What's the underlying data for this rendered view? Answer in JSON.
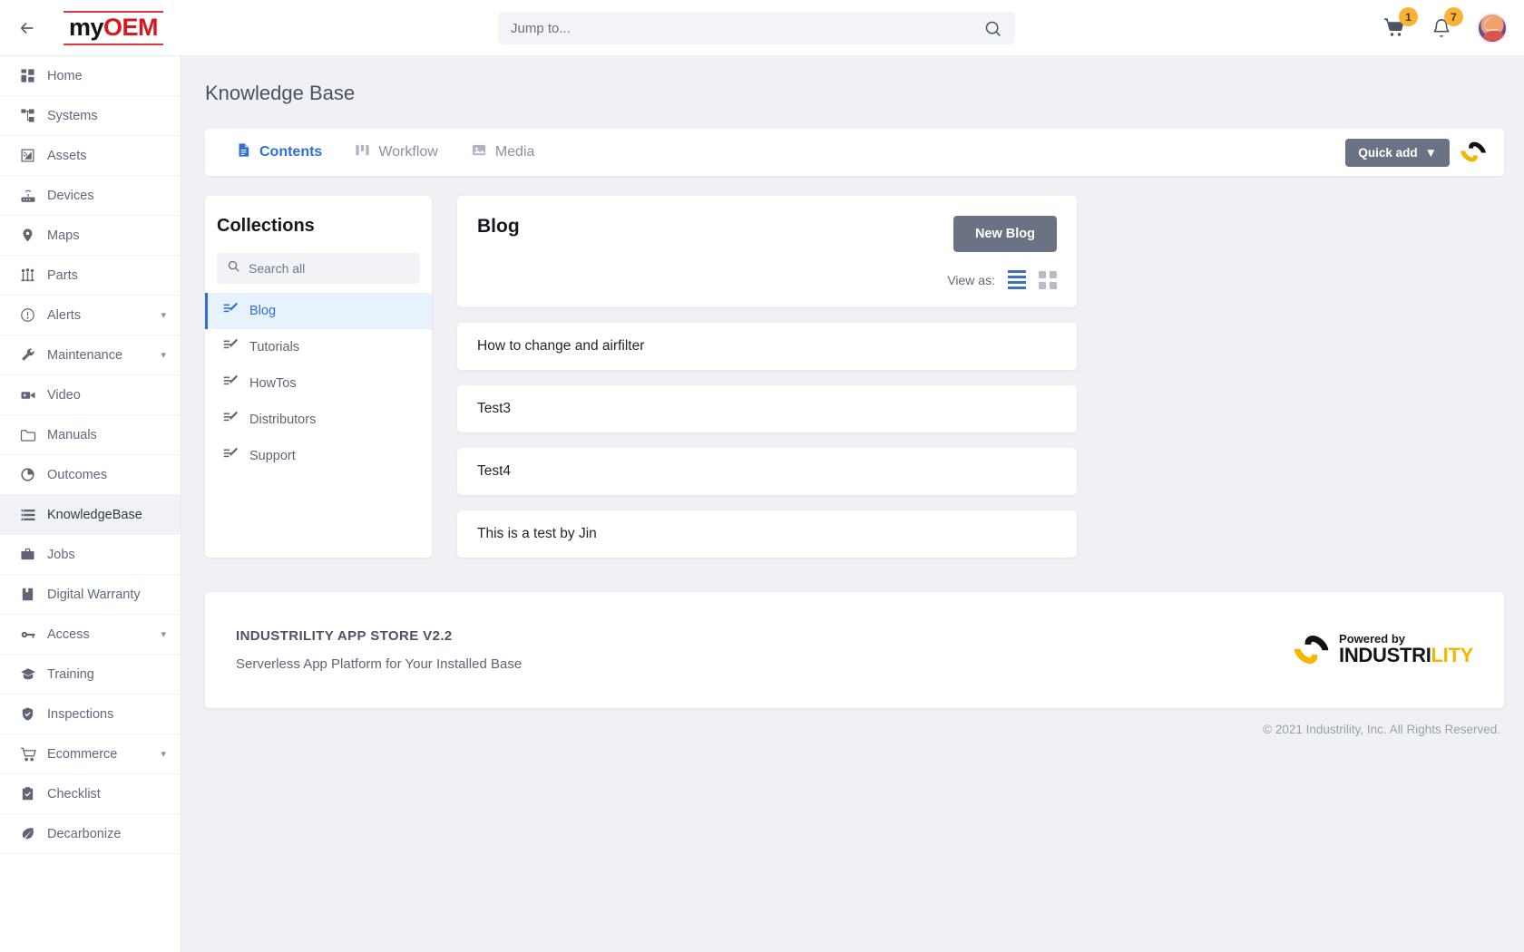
{
  "topbar": {
    "back_icon": "arrow-left-icon",
    "logo": {
      "part1": "my",
      "part2": "OEM"
    },
    "search": {
      "placeholder": "Jump to...",
      "value": "",
      "icon": "search-icon"
    },
    "cart": {
      "icon": "cart-icon",
      "badge": "1"
    },
    "notifications": {
      "icon": "bell-icon",
      "badge": "7"
    },
    "avatar": {
      "icon": "user-avatar"
    }
  },
  "sidebar": {
    "items": [
      {
        "label": "Home",
        "icon": "dashboard-icon",
        "active": false,
        "chevron": false
      },
      {
        "label": "Systems",
        "icon": "sitemap-icon",
        "active": false,
        "chevron": false
      },
      {
        "label": "Assets",
        "icon": "asset-cast-icon",
        "active": false,
        "chevron": false
      },
      {
        "label": "Devices",
        "icon": "router-icon",
        "active": false,
        "chevron": false
      },
      {
        "label": "Maps",
        "icon": "map-pin-icon",
        "active": false,
        "chevron": false
      },
      {
        "label": "Parts",
        "icon": "parts-icon",
        "active": false,
        "chevron": false
      },
      {
        "label": "Alerts",
        "icon": "alert-circle-icon",
        "active": false,
        "chevron": true
      },
      {
        "label": "Maintenance",
        "icon": "wrench-icon",
        "active": false,
        "chevron": true
      },
      {
        "label": "Video",
        "icon": "video-camera-icon",
        "active": false,
        "chevron": false
      },
      {
        "label": "Manuals",
        "icon": "folder-icon",
        "active": false,
        "chevron": false
      },
      {
        "label": "Outcomes",
        "icon": "pie-chart-icon",
        "active": false,
        "chevron": false
      },
      {
        "label": "KnowledgeBase",
        "icon": "list-icon",
        "active": true,
        "chevron": false
      },
      {
        "label": "Jobs",
        "icon": "briefcase-icon",
        "active": false,
        "chevron": false
      },
      {
        "label": "Digital Warranty",
        "icon": "book-icon",
        "active": false,
        "chevron": false
      },
      {
        "label": "Access",
        "icon": "key-icon",
        "active": false,
        "chevron": true
      },
      {
        "label": "Training",
        "icon": "graduation-cap-icon",
        "active": false,
        "chevron": false
      },
      {
        "label": "Inspections",
        "icon": "shield-check-icon",
        "active": false,
        "chevron": false
      },
      {
        "label": "Ecommerce",
        "icon": "shopping-cart-icon",
        "active": false,
        "chevron": true
      },
      {
        "label": "Checklist",
        "icon": "clipboard-check-icon",
        "active": false,
        "chevron": false
      },
      {
        "label": "Decarbonize",
        "icon": "leaf-icon",
        "active": false,
        "chevron": false
      }
    ]
  },
  "page": {
    "title": "Knowledge Base"
  },
  "tabs": [
    {
      "label": "Contents",
      "icon": "document-icon",
      "active": true
    },
    {
      "label": "Workflow",
      "icon": "columns-icon",
      "active": false
    },
    {
      "label": "Media",
      "icon": "image-icon",
      "active": false
    }
  ],
  "toolbar": {
    "quick_add_label": "Quick add",
    "quick_add_caret": "▼",
    "brand_mark": "industrility-mark-icon"
  },
  "collections": {
    "heading": "Collections",
    "search": {
      "placeholder": "Search all",
      "value": "",
      "icon": "search-icon"
    },
    "items": [
      {
        "label": "Blog",
        "icon": "article-icon",
        "active": true
      },
      {
        "label": "Tutorials",
        "icon": "article-icon",
        "active": false
      },
      {
        "label": "HowTos",
        "icon": "article-icon",
        "active": false
      },
      {
        "label": "Distributors",
        "icon": "article-icon",
        "active": false
      },
      {
        "label": "Support",
        "icon": "article-icon",
        "active": false
      }
    ]
  },
  "blog": {
    "title": "Blog",
    "new_button": "New Blog",
    "view_as_label": "View as:",
    "view_modes": [
      {
        "name": "list-view",
        "active": true
      },
      {
        "name": "grid-view",
        "active": false
      }
    ],
    "entries": [
      {
        "title": "How to change and airfilter"
      },
      {
        "title": "Test3"
      },
      {
        "title": "Test4"
      },
      {
        "title": "This is a test by Jin"
      }
    ]
  },
  "footer": {
    "title": "INDUSTRILITY APP STORE V2.2",
    "subtitle": "Serverless App Platform for Your Installed Base",
    "powered_by": "Powered by",
    "brand_dark": "INDUSTRI",
    "brand_accent": "LITY",
    "copyright": "© 2021 Industrility, Inc. All Rights Reserved."
  },
  "colors": {
    "accent_blue": "#2f6fd4",
    "brand_red": "#d6191f",
    "brand_yellow": "#f5b500",
    "badge_orange": "#f9b233",
    "button_gray": "#6a7283"
  }
}
